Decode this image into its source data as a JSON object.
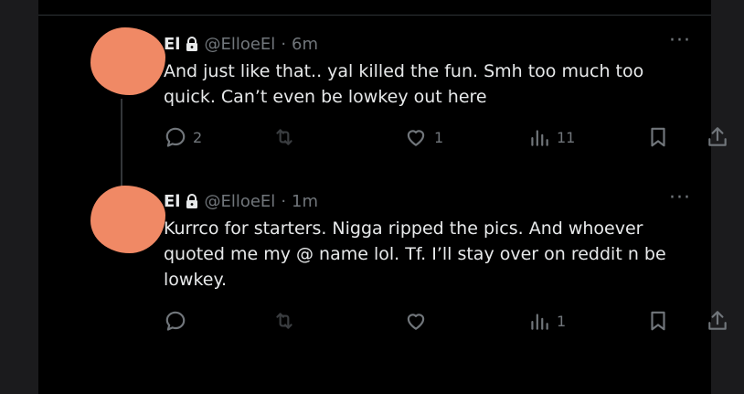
{
  "colors": {
    "background": "#000000",
    "outer": "#1b1b1d",
    "text": "#e7e9ea",
    "muted": "#71767b",
    "avatar": "#f08965"
  },
  "tweets": [
    {
      "name": "El",
      "handle": "@ElloeEl",
      "separator": "·",
      "time": "6m",
      "lines": [
        "And just like that.. yal killed the fun. Smh too much too",
        "quick. Can’t even be lowkey out here"
      ],
      "replies": "2",
      "retweets": "",
      "likes": "1",
      "views": "11"
    },
    {
      "name": "El",
      "handle": "@ElloeEl",
      "separator": "·",
      "time": "1m",
      "lines": [
        "Kurrco for starters. Nigga ripped the pics. And whoever",
        "quoted me my @ name lol. Tf. I’ll stay over on reddit n be",
        "lowkey."
      ],
      "replies": "",
      "retweets": "",
      "likes": "",
      "views": "1"
    }
  ],
  "icons": {
    "lock": "lock-icon",
    "more": "more-icon",
    "reply": "reply-icon",
    "retweet": "retweet-icon",
    "like": "heart-icon",
    "views": "views-icon",
    "bookmark": "bookmark-icon",
    "share": "share-icon"
  }
}
